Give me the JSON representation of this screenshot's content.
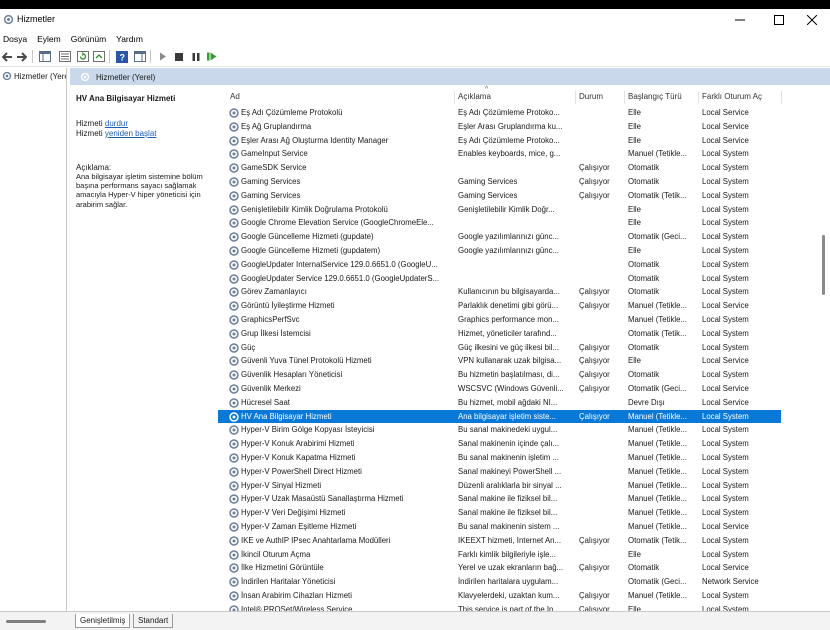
{
  "window": {
    "title": "Hizmetler"
  },
  "menu": [
    "Dosya",
    "Eylem",
    "Görünüm",
    "Yardım"
  ],
  "tree": {
    "root_label": "Hizmetler (Yerel)"
  },
  "content_header": "Hizmetler (Yerel)",
  "detail": {
    "service_name": "HV Ana Bilgisayar Hizmeti",
    "line1_prefix": "Hizmeti ",
    "stop_link": "durdur",
    "line2_prefix": "Hizmeti ",
    "restart_link": "yeniden başlat",
    "description_label": "Açıklama:",
    "description_text": "Ana bilgisayar işletim sistemine bölüm başına performans sayacı sağlamak amacıyla Hyper-V hiper yöneticisi için arabirim sağlar."
  },
  "columns": {
    "name": "Ad",
    "description": "Açıklama",
    "status": "Durum",
    "startup": "Başlangıç Türü",
    "logon": "Farklı Oturum Aç"
  },
  "rows": [
    {
      "name": "Eş Adı Çözümleme Protokolü",
      "description": "Eş Adı Çözümleme Protoko...",
      "status": "",
      "startup": "Elle",
      "logon": "Local Service"
    },
    {
      "name": "Eş Ağ Gruplandırma",
      "description": "Eşler Arası Gruplandırma ku...",
      "status": "",
      "startup": "Elle",
      "logon": "Local Service"
    },
    {
      "name": "Eşler Arası Ağ Oluşturma Identity Manager",
      "description": "Eş Adı Çözümleme Protoko...",
      "status": "",
      "startup": "Elle",
      "logon": "Local Service"
    },
    {
      "name": "GameInput Service",
      "description": "Enables keyboards, mice, g...",
      "status": "",
      "startup": "Manuel (Tetikle...",
      "logon": "Local System"
    },
    {
      "name": "GameSDK Service",
      "description": "",
      "status": "Çalışıyor",
      "startup": "Otomatik",
      "logon": "Local System"
    },
    {
      "name": "Gaming Services",
      "description": "Gaming Services",
      "status": "Çalışıyor",
      "startup": "Otomatik",
      "logon": "Local System"
    },
    {
      "name": "Gaming Services",
      "description": "Gaming Services",
      "status": "Çalışıyor",
      "startup": "Otomatik (Tetik...",
      "logon": "Local System"
    },
    {
      "name": "Genişletilebilir Kimlik Doğrulama Protokolü",
      "description": "Genişletilebilir Kimlik Doğr...",
      "status": "",
      "startup": "Elle",
      "logon": "Local System"
    },
    {
      "name": "Google Chrome Elevation Service (GoogleChromeEle...",
      "description": "",
      "status": "",
      "startup": "Elle",
      "logon": "Local System"
    },
    {
      "name": "Google Güncelleme Hizmeti (gupdate)",
      "description": "Google yazılımlarınızı günc...",
      "status": "",
      "startup": "Otomatik (Geci...",
      "logon": "Local System"
    },
    {
      "name": "Google Güncelleme Hizmeti (gupdatem)",
      "description": "Google yazılımlarınızı günc...",
      "status": "",
      "startup": "Elle",
      "logon": "Local System"
    },
    {
      "name": "GoogleUpdater InternalService 129.0.6651.0 (GoogleU...",
      "description": "",
      "status": "",
      "startup": "Otomatik",
      "logon": "Local System"
    },
    {
      "name": "GoogleUpdater Service 129.0.6651.0 (GoogleUpdaterS...",
      "description": "",
      "status": "",
      "startup": "Otomatik",
      "logon": "Local System"
    },
    {
      "name": "Görev Zamanlayıcı",
      "description": "Kullanıcının bu bilgisayarda...",
      "status": "Çalışıyor",
      "startup": "Otomatik",
      "logon": "Local System"
    },
    {
      "name": "Görüntü İyileştirme Hizmeti",
      "description": "Parlaklık denetimi gibi görü...",
      "status": "Çalışıyor",
      "startup": "Manuel (Tetikle...",
      "logon": "Local Service"
    },
    {
      "name": "GraphicsPerfSvc",
      "description": "Graphics performance mon...",
      "status": "",
      "startup": "Manuel (Tetikle...",
      "logon": "Local System"
    },
    {
      "name": "Grup İlkesi İstemcisi",
      "description": "Hizmet, yöneticiler tarafınd...",
      "status": "",
      "startup": "Otomatik (Tetik...",
      "logon": "Local System"
    },
    {
      "name": "Güç",
      "description": "Güç ilkesini ve güç ilkesi bil...",
      "status": "Çalışıyor",
      "startup": "Otomatik",
      "logon": "Local System"
    },
    {
      "name": "Güvenli Yuva Tünel Protokolü Hizmeti",
      "description": "VPN kullanarak uzak bilgisa...",
      "status": "Çalışıyor",
      "startup": "Elle",
      "logon": "Local Service"
    },
    {
      "name": "Güvenlik Hesapları Yöneticisi",
      "description": "Bu hizmetin başlatılması, di...",
      "status": "Çalışıyor",
      "startup": "Otomatik",
      "logon": "Local System"
    },
    {
      "name": "Güvenlik Merkezi",
      "description": "WSCSVC (Windows Güvenli...",
      "status": "Çalışıyor",
      "startup": "Otomatik (Geci...",
      "logon": "Local Service"
    },
    {
      "name": "Hücresel Saat",
      "description": "Bu hizmet, mobil ağdaki NI...",
      "status": "",
      "startup": "Devre Dışı",
      "logon": "Local Service"
    },
    {
      "name": "HV Ana Bilgisayar Hizmeti",
      "description": "Ana bilgisayar işletim siste...",
      "status": "Çalışıyor",
      "startup": "Manuel (Tetikle...",
      "logon": "Local System",
      "selected": true
    },
    {
      "name": "Hyper-V Birim Gölge Kopyası İsteyicisi",
      "description": "Bu sanal makinedeki uygul...",
      "status": "",
      "startup": "Manuel (Tetikle...",
      "logon": "Local System"
    },
    {
      "name": "Hyper-V Konuk Arabirimi Hizmeti",
      "description": "Sanal makinenin içinde çalı...",
      "status": "",
      "startup": "Manuel (Tetikle...",
      "logon": "Local System"
    },
    {
      "name": "Hyper-V Konuk Kapatma Hizmeti",
      "description": "Bu sanal makinenin işletim ...",
      "status": "",
      "startup": "Manuel (Tetikle...",
      "logon": "Local System"
    },
    {
      "name": "Hyper-V PowerShell Direct Hizmeti",
      "description": "Sanal makineyi PowerShell ...",
      "status": "",
      "startup": "Manuel (Tetikle...",
      "logon": "Local System"
    },
    {
      "name": "Hyper-V Sinyal Hizmeti",
      "description": "Düzenli aralıklarla bir sinyal ...",
      "status": "",
      "startup": "Manuel (Tetikle...",
      "logon": "Local System"
    },
    {
      "name": "Hyper-V Uzak Masaüstü Sanallaştırma Hizmeti",
      "description": "Sanal makine ile fiziksel bil...",
      "status": "",
      "startup": "Manuel (Tetikle...",
      "logon": "Local System"
    },
    {
      "name": "Hyper-V Veri Değişimi Hizmeti",
      "description": "Sanal makine ile fiziksel bil...",
      "status": "",
      "startup": "Manuel (Tetikle...",
      "logon": "Local System"
    },
    {
      "name": "Hyper-V Zaman Eşitleme Hizmeti",
      "description": "Bu sanal makinenin sistem ...",
      "status": "",
      "startup": "Manuel (Tetikle...",
      "logon": "Local Service"
    },
    {
      "name": "IKE ve AuthIP IPsec Anahtarlama Modülleri",
      "description": "IKEEXT hizmeti, Internet An...",
      "status": "Çalışıyor",
      "startup": "Otomatik (Tetik...",
      "logon": "Local System"
    },
    {
      "name": "İkincil Oturum Açma",
      "description": "Farklı kimlik bilgileriyle işle...",
      "status": "",
      "startup": "Elle",
      "logon": "Local System"
    },
    {
      "name": "İlke Hizmetini Görüntüle",
      "description": "Yerel ve uzak ekranların bağ...",
      "status": "Çalışıyor",
      "startup": "Otomatik",
      "logon": "Local Service"
    },
    {
      "name": "İndirilen Haritalar Yöneticisi",
      "description": "İndirilen haritalara uygulam...",
      "status": "",
      "startup": "Otomatik (Geci...",
      "logon": "Network Service"
    },
    {
      "name": "İnsan Arabirim Cihazları Hizmeti",
      "description": "Klavyelerdeki, uzaktan kum...",
      "status": "Çalışıyor",
      "startup": "Manuel (Tetikle...",
      "logon": "Local System"
    },
    {
      "name": "Intel® PROSet/Wireless Service",
      "description": "This service is part of the In...",
      "status": "Çalışıyor",
      "startup": "Elle",
      "logon": "Local System"
    }
  ],
  "tabs": [
    "Genişletilmiş",
    "Standart"
  ]
}
